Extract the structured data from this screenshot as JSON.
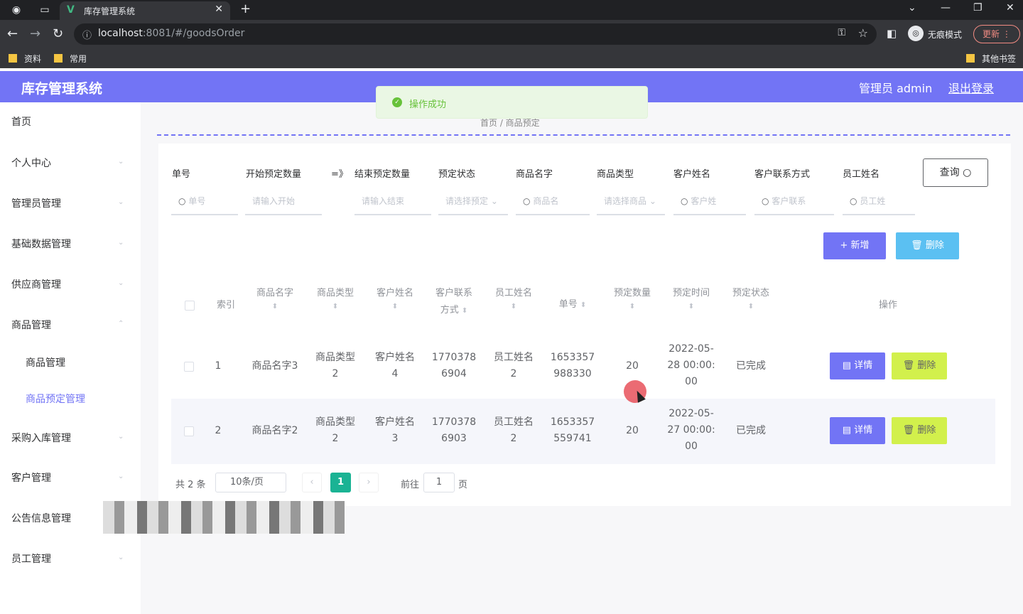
{
  "browser": {
    "tab_title": "库存管理系统",
    "url_host": "localhost",
    "url_rest": ":8081/#/goodsOrder",
    "incognito_label": "无痕模式",
    "update_label": "更新",
    "bookmarks": [
      "资料",
      "常用"
    ],
    "other_bookmarks": "其他书签"
  },
  "header": {
    "logo": "库存管理系统",
    "admin": "管理员 admin",
    "logout": "退出登录"
  },
  "toast": {
    "message": "操作成功"
  },
  "breadcrumb": "首页 / 商品预定",
  "sidebar": {
    "items": [
      {
        "label": "首页"
      },
      {
        "label": "个人中心"
      },
      {
        "label": "管理员管理"
      },
      {
        "label": "基础数据管理"
      },
      {
        "label": "供应商管理"
      },
      {
        "label": "商品管理"
      },
      {
        "label": "商品管理"
      },
      {
        "label": "商品预定管理"
      },
      {
        "label": "采购入库管理"
      },
      {
        "label": "客户管理"
      },
      {
        "label": "公告信息管理"
      },
      {
        "label": "员工管理"
      }
    ]
  },
  "filters": {
    "labels": [
      "单号",
      "开始预定数量",
      "=》",
      "结束预定数量",
      "预定状态",
      "商品名字",
      "商品类型",
      "客户姓名",
      "客户联系方式",
      "员工姓名"
    ],
    "placeholders": [
      "单号",
      "请输入开始",
      "请输入结束",
      "请选择预定",
      "商品名",
      "请选择商品",
      "客户姓",
      "客户联系",
      "员工姓"
    ],
    "query_button": "查询"
  },
  "actions": {
    "add": "新增",
    "delete": "删除"
  },
  "table": {
    "headers": [
      "索引",
      "商品名字",
      "商品类型",
      "客户姓名",
      "客户联系方式",
      "员工姓名",
      "单号",
      "预定数量",
      "预定时间",
      "预定状态",
      "操作"
    ],
    "header_lines": {
      "contact_1": "客户联系",
      "contact_2": "方式"
    },
    "rows": [
      {
        "index": "1",
        "goods_name": "商品名字3",
        "goods_type_1": "商品类型",
        "goods_type_2": "2",
        "customer_1": "客户姓名",
        "customer_2": "4",
        "phone_1": "1770378",
        "phone_2": "6904",
        "staff_1": "员工姓名",
        "staff_2": "2",
        "order_1": "1653357",
        "order_2": "988330",
        "qty": "20",
        "time_1": "2022-05-",
        "time_2": "28 00:00:",
        "time_3": "00",
        "status": "已完成"
      },
      {
        "index": "2",
        "goods_name": "商品名字2",
        "goods_type_1": "商品类型",
        "goods_type_2": "2",
        "customer_1": "客户姓名",
        "customer_2": "3",
        "phone_1": "1770378",
        "phone_2": "6903",
        "staff_1": "员工姓名",
        "staff_2": "2",
        "order_1": "1653357",
        "order_2": "559741",
        "qty": "20",
        "time_1": "2022-05-",
        "time_2": "27 00:00:",
        "time_3": "00",
        "status": "已完成"
      }
    ],
    "detail_label": "详情",
    "delete_label": "删除"
  },
  "pagination": {
    "total": "共 2 条",
    "page_size": "10条/页",
    "current": "1",
    "goto_prefix": "前往",
    "goto_value": "1",
    "goto_suffix": "页"
  },
  "colors": {
    "primary": "#7274f5",
    "info": "#5bc0f2",
    "lime": "#d2f04c",
    "success": "#67c23a"
  }
}
